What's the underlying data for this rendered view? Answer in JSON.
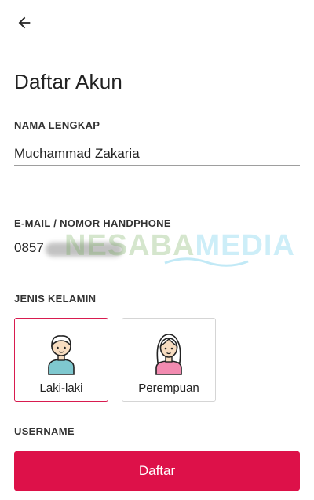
{
  "header": {
    "back_icon": "arrow-left-icon",
    "title": "Daftar Akun"
  },
  "form": {
    "full_name": {
      "label": "NAMA LENGKAP",
      "value": "Muchammad Zakaria"
    },
    "email_phone": {
      "label": "E-MAIL / NOMOR HANDPHONE",
      "value": "0857"
    },
    "gender": {
      "label": "JENIS KELAMIN",
      "options": [
        {
          "label": "Laki-laki",
          "icon": "male-avatar-icon",
          "selected": true
        },
        {
          "label": "Perempuan",
          "icon": "female-avatar-icon",
          "selected": false
        }
      ]
    },
    "username": {
      "label": "USERNAME"
    },
    "submit_label": "Daftar"
  },
  "watermark": {
    "part1": "NESABA",
    "part2": "MEDIA"
  },
  "colors": {
    "accent": "#dd1149",
    "selected_border": "#d81b4f",
    "male_shirt": "#7fc8cf",
    "female_shirt": "#f28bb0",
    "skin": "#f7dcc0"
  }
}
